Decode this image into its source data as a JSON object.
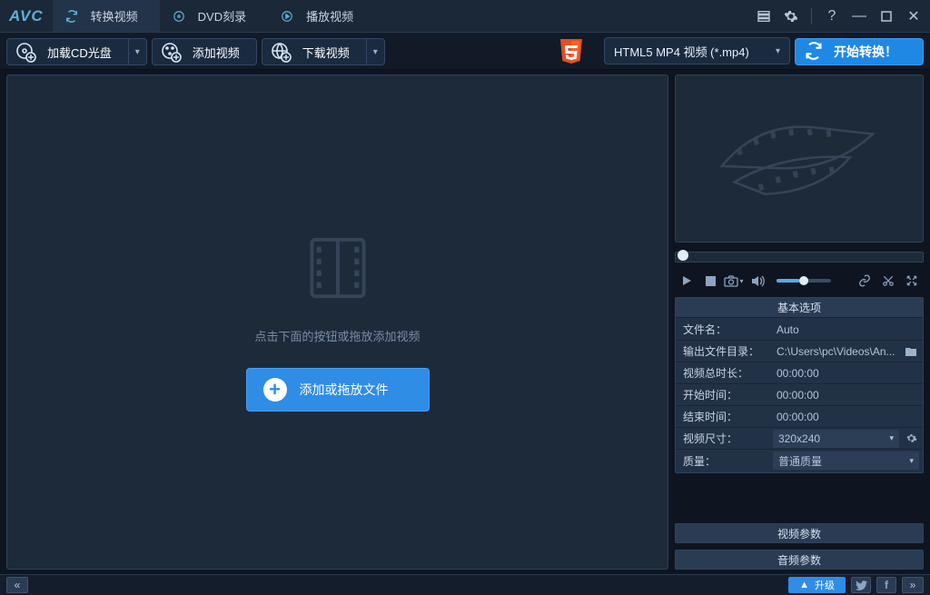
{
  "app": {
    "name": "AVC"
  },
  "tabs": [
    {
      "label": "转换视频",
      "icon": "refresh"
    },
    {
      "label": "DVD刻录",
      "icon": "disc"
    },
    {
      "label": "播放视频",
      "icon": "play"
    }
  ],
  "toolbar": {
    "load_cd": "加载CD光盘",
    "add_video": "添加视频",
    "download_video": "下载视频"
  },
  "format": {
    "selected": "HTML5 MP4 视频 (*.mp4)",
    "icon_label": "HTML5"
  },
  "convert": {
    "label": "开始转换！"
  },
  "dropzone": {
    "hint": "点击下面的按钮或拖放添加视频",
    "button": "添加或拖放文件"
  },
  "panels": {
    "basic": "基本选项",
    "video_params": "视频参数",
    "audio_params": "音频参数"
  },
  "props": {
    "filename_label": "文件名：",
    "filename_value": "Auto",
    "output_label": "输出文件目录：",
    "output_value": "C:\\Users\\pc\\Videos\\An...",
    "duration_label": "视频总时长：",
    "duration_value": "00:00:00",
    "start_label": "开始时间：",
    "start_value": "00:00:00",
    "end_label": "结束时间：",
    "end_value": "00:00:00",
    "size_label": "视频尺寸：",
    "size_value": "320x240",
    "quality_label": "质量：",
    "quality_value": "普通质量"
  },
  "bottom": {
    "upgrade": "升级"
  }
}
